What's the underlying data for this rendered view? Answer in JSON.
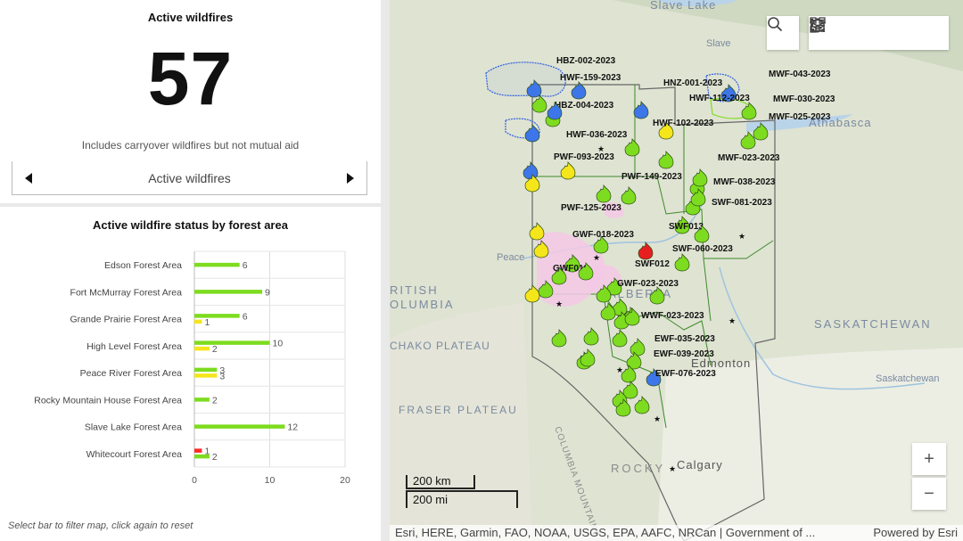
{
  "kpi": {
    "title": "Active wildfires",
    "value": "57",
    "subtitle": "Includes carryover wildfires but not mutual aid",
    "selector_label": "Active wildfires"
  },
  "chart_panel": {
    "title": "Active wildfire status by forest area",
    "footnote": "Select bar to filter map, click again to reset"
  },
  "chart_data": {
    "type": "bar",
    "orientation": "horizontal",
    "title": "Active wildfire status by forest area",
    "categories": [
      "Edson Forest Area",
      "Fort McMurray Forest Area",
      "Grande Prairie Forest Area",
      "High Level Forest Area",
      "Peace River Forest Area",
      "Rocky Mountain House Forest Area",
      "Slave Lake Forest Area",
      "Whitecourt Forest Area"
    ],
    "series": [
      {
        "color": "#ff2b2b",
        "values": [
          0,
          0,
          0,
          0,
          0,
          0,
          0,
          1
        ]
      },
      {
        "color": "#7ddc1f",
        "values": [
          6,
          9,
          6,
          10,
          3,
          2,
          12,
          2
        ]
      },
      {
        "color": "#f5e51b",
        "values": [
          0,
          0,
          1,
          2,
          3,
          0,
          0,
          0
        ]
      }
    ],
    "xlim": [
      0,
      20
    ],
    "xticks": [
      "0",
      "10",
      "20"
    ],
    "grid": true
  },
  "map": {
    "toolbar": {
      "search": "search-icon",
      "home": "home-icon",
      "legend": "legend-icon",
      "layers": "layers-icon",
      "qr": "qr-code-icon"
    },
    "zoom_in": "+",
    "zoom_out": "−",
    "scale_km": "200 km",
    "scale_mi": "200 mi",
    "attribution": "Esri, HERE, Garmin, FAO, NOAA, USGS, EPA, AAFC, NRCan | Government of ...",
    "powered_by": "Powered by Esri",
    "places": [
      {
        "name": "Slave Lake"
      },
      {
        "name": "Slave"
      },
      {
        "name": "Athabasca"
      },
      {
        "name": "Peace"
      },
      {
        "name": "RITISH"
      },
      {
        "name": "OLUMBIA"
      },
      {
        "name": "ALBERTA"
      },
      {
        "name": "SASKATCHEWAN"
      },
      {
        "name": "CHAKO PLATEAU"
      },
      {
        "name": "FRASER PLATEAU"
      },
      {
        "name": "Edmonton"
      },
      {
        "name": "Calgary"
      },
      {
        "name": "Saskatchewan"
      },
      {
        "name": "COLUMBIA MOUNTAINS"
      },
      {
        "name": "ROCKY"
      }
    ],
    "fires": [
      "HBZ-002-2023",
      "HWF-159-2023",
      "HBZ-004-2023",
      "HNZ-001-2023",
      "MWF-043-2023",
      "HWF-112-2023",
      "MWF-030-2023",
      "MWF-025-2023",
      "HWF-102-2023",
      "HWF-036-2023",
      "PWF-093-2023",
      "MWF-023-2023",
      "PWF-149-2023",
      "MWF-038-2023",
      "SWF-081-2023",
      "PWF-125-2023",
      "SWF013",
      "GWF-018-2023",
      "SWF-060-2023",
      "SWF012",
      "GWF010",
      "GWF-023-2023",
      "WWF-023-2023",
      "EWF-035-2023",
      "EWF-039-2023",
      "EWF-076-2023"
    ]
  }
}
